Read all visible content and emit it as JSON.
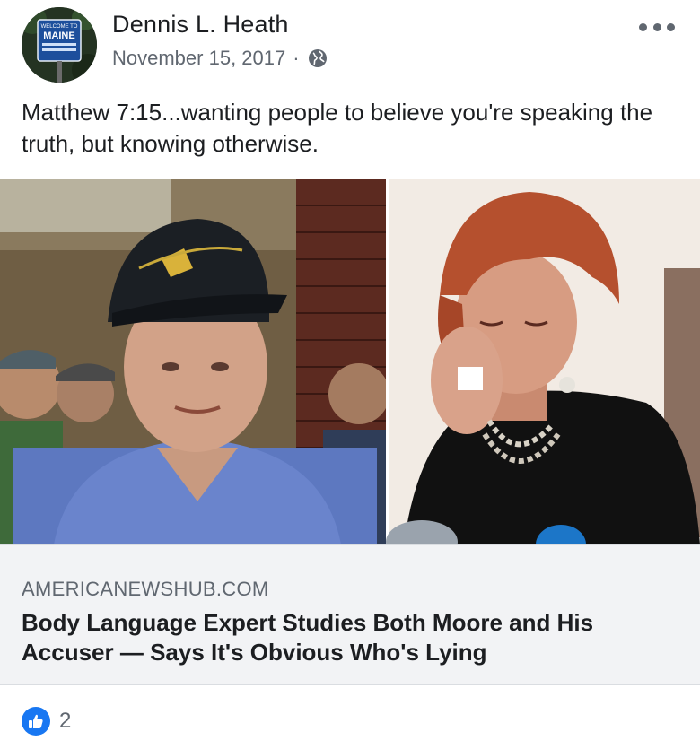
{
  "post": {
    "author": "Dennis L. Heath",
    "date": "November 15, 2017",
    "separator": "·",
    "privacy_icon": "globe-icon",
    "text": "Matthew 7:15...wanting people to believe you're speaking the truth, but knowing otherwise.",
    "avatar_sign": {
      "line1": "WELCOME TO",
      "line2": "MAINE"
    }
  },
  "link_card": {
    "domain": "AMERICANEWSHUB.COM",
    "headline": "Body Language Expert Studies Both Moore and His Accuser — Says It's Obvious Who's Lying"
  },
  "reactions": {
    "icon": "thumbs-up-icon",
    "count": "2"
  },
  "colors": {
    "accent": "#1877f2",
    "secondary_text": "#606770",
    "card_background": "#f2f3f5"
  }
}
